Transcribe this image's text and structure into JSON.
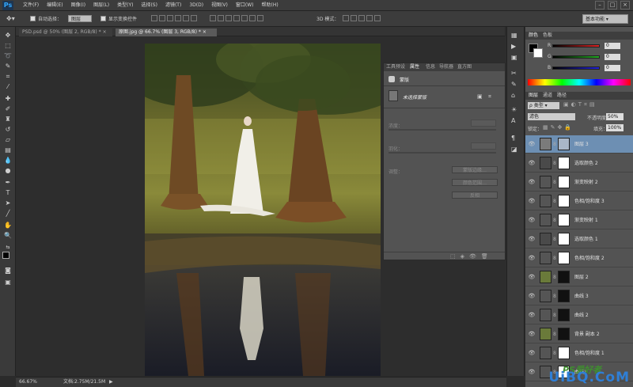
{
  "menubar": {
    "logo": "Ps",
    "items": [
      "文件(F)",
      "编辑(E)",
      "图像(I)",
      "图层(L)",
      "类型(Y)",
      "选择(S)",
      "滤镜(T)",
      "3D(D)",
      "视图(V)",
      "窗口(W)",
      "帮助(H)"
    ]
  },
  "options": {
    "auto_select_label": "自动选择：",
    "auto_select_value": "图层",
    "show_transform_label": "显示变换控件",
    "mode_3d_label": "3D 模式："
  },
  "workspace": "基本功能",
  "doc_tabs": [
    {
      "label": "PSD.psd @ 50% (图层 2, RGB/8) *",
      "close": "×"
    },
    {
      "label": "原图.jpg @ 66.7% (图层 3, RGB/8) *",
      "close": "×"
    }
  ],
  "status": {
    "zoom": "66.67%",
    "doc": "文档:2.75M/21.5M"
  },
  "properties_panel": {
    "tabs": [
      "工具预设",
      "属性",
      "信息",
      "导航器",
      "直方图"
    ],
    "header": "蒙版",
    "mask_label": "未选择蒙版",
    "density_label": "浓度：",
    "feather_label": "羽化：",
    "adjust_label": "调整：",
    "btn_mask_edge": "蒙版边缘…",
    "btn_color_range": "颜色范围…",
    "btn_invert": "反相"
  },
  "color_panel": {
    "tabs": [
      "颜色",
      "色板"
    ],
    "channels": [
      {
        "name": "R",
        "value": "0",
        "color": "#d22"
      },
      {
        "name": "G",
        "value": "0",
        "color": "#2a2"
      },
      {
        "name": "B",
        "value": "0",
        "color": "#22d"
      }
    ]
  },
  "layers_panel": {
    "tabs": [
      "图层",
      "通道",
      "路径"
    ],
    "filter_kind": "类型",
    "blend_mode": "滤色",
    "opacity_label": "不透明度：",
    "opacity_value": "50%",
    "lock_label": "锁定：",
    "fill_label": "填充：",
    "fill_value": "100%",
    "layers": [
      {
        "name": "图层 3",
        "selected": true,
        "t1": "#7b7b7b",
        "t2": "#a9b7c8"
      },
      {
        "name": "选取颜色 2",
        "selected": false,
        "t1": "#4a4a4a",
        "t2": "#ffffff"
      },
      {
        "name": "渐变映射 2",
        "selected": false,
        "t1": "#555555",
        "t2": "#ffffff"
      },
      {
        "name": "色相/饱和度 3",
        "selected": false,
        "t1": "#555555",
        "t2": "#ffffff"
      },
      {
        "name": "渐变映射 1",
        "selected": false,
        "t1": "#555555",
        "t2": "#ffffff"
      },
      {
        "name": "选取颜色 1",
        "selected": false,
        "t1": "#4a4a4a",
        "t2": "#ffffff"
      },
      {
        "name": "色相/饱和度 2",
        "selected": false,
        "t1": "#555555",
        "t2": "#ffffff"
      },
      {
        "name": "图层 2",
        "selected": false,
        "t1": "#6a7a3a",
        "t2": "#111111"
      },
      {
        "name": "曲线 3",
        "selected": false,
        "t1": "#555555",
        "t2": "#111111"
      },
      {
        "name": "曲线 2",
        "selected": false,
        "t1": "#555555",
        "t2": "#111111"
      },
      {
        "name": "背景 副本 2",
        "selected": false,
        "t1": "#6a7a3a",
        "t2": "#111111"
      },
      {
        "name": "色相/饱和度 1",
        "selected": false,
        "t1": "#555555",
        "t2": "#ffffff"
      },
      {
        "name": "曲线1",
        "selected": false,
        "t1": "#555555",
        "t2": "#ffffff"
      }
    ]
  },
  "watermark": {
    "brand": "UiBQ.CoM",
    "cn": "PS爱好者"
  }
}
